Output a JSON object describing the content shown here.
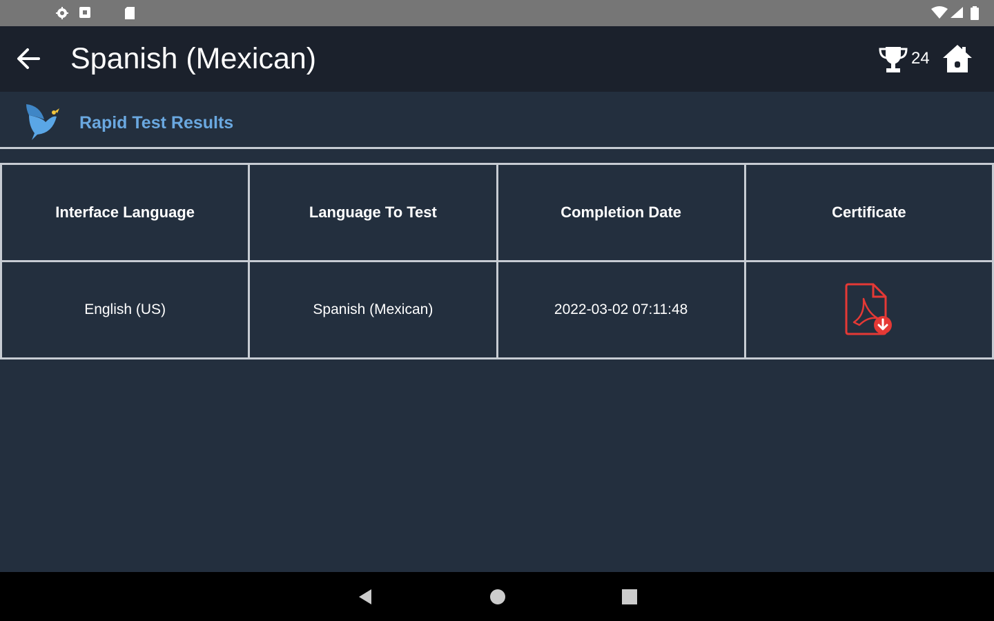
{
  "app_bar": {
    "title": "Spanish (Mexican)",
    "trophy_count": "24"
  },
  "subheader": {
    "title": "Rapid Test Results"
  },
  "table": {
    "headers": [
      "Interface Language",
      "Language To Test",
      "Completion Date",
      "Certificate"
    ],
    "rows": [
      {
        "interface_language": "English (US)",
        "language_to_test": "Spanish (Mexican)",
        "completion_date": "2022-03-02 07:11:48",
        "certificate_icon": "pdf-download-icon"
      }
    ]
  },
  "icons": {
    "status_bar": [
      "settings-icon",
      "notification-icon",
      "sd-card-icon",
      "wifi-icon",
      "signal-icon",
      "battery-icon"
    ],
    "app_bar": [
      "back-arrow-icon",
      "trophy-icon",
      "home-icon"
    ],
    "nav_bar": [
      "nav-back-icon",
      "nav-home-icon",
      "nav-recents-icon"
    ]
  },
  "colors": {
    "background": "#232f3e",
    "app_bar": "#1b212c",
    "status_bar": "#767676",
    "accent_blue": "#6aa8e0",
    "pdf_red": "#e53935",
    "grid_lines": "#c7ccd3"
  }
}
